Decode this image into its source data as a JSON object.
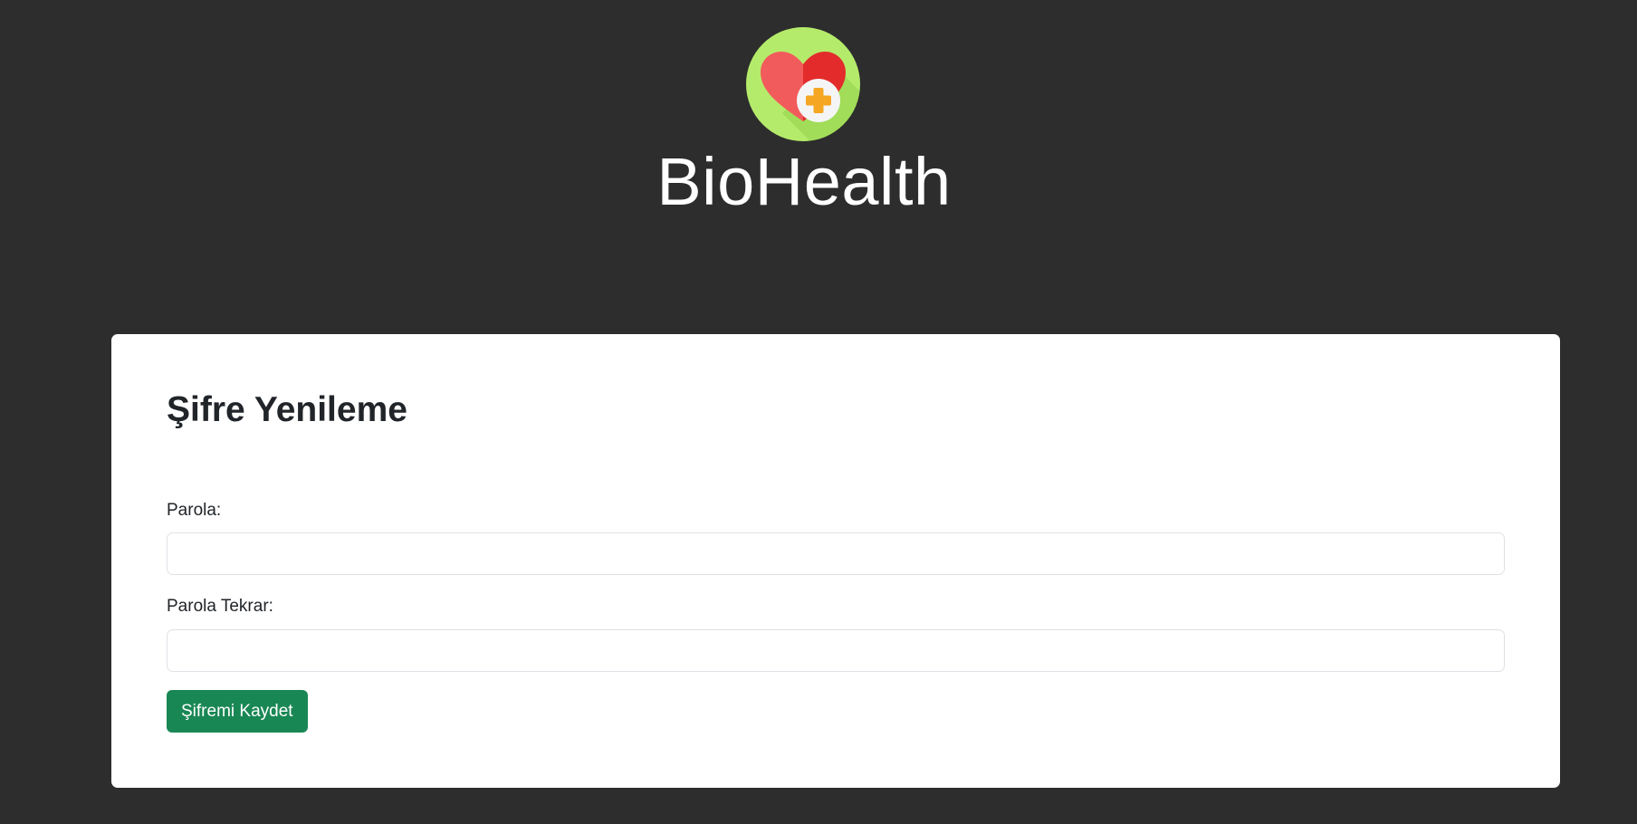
{
  "header": {
    "brand_title": "BioHealth",
    "logo_icon": "heart-plus-icon",
    "logo_colors": {
      "background": "#b5eb6b",
      "heart_left": "#f25b5b",
      "heart_right": "#e32b2b",
      "badge": "#f5f5f5",
      "cross": "#f5a623"
    }
  },
  "form": {
    "title": "Şifre Yenileme",
    "password_label": "Parola:",
    "password_value": "",
    "password_repeat_label": "Parola Tekrar:",
    "password_repeat_value": "",
    "save_button_label": "Şifremi Kaydet"
  },
  "colors": {
    "page_background": "#2d2d2d",
    "card_background": "#ffffff",
    "primary_button": "#198754",
    "text": "#212529"
  }
}
